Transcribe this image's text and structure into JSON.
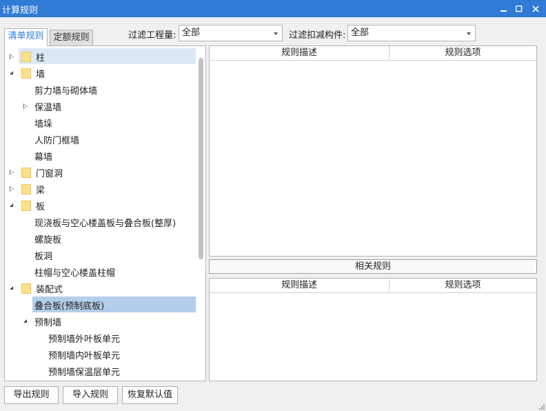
{
  "window": {
    "title": "计算规则",
    "minimize": "—",
    "maximize": "☐",
    "close": "✕"
  },
  "tabs": {
    "active": "清单规则",
    "inactive": "定额规则"
  },
  "filters": {
    "quantity_label": "过滤工程量:",
    "quantity_value": "全部",
    "deduct_label": "过滤扣减构件:",
    "deduct_value": "全部"
  },
  "tree": {
    "items": [
      {
        "label": "柱",
        "level": 0,
        "expander": "collapsed",
        "folder": true,
        "state": "hover"
      },
      {
        "label": "墙",
        "level": 0,
        "expander": "expanded",
        "folder": true
      },
      {
        "label": "剪力墙与砌体墙",
        "level": 1
      },
      {
        "label": "保温墙",
        "level": 1,
        "expander": "collapsed"
      },
      {
        "label": "墙垛",
        "level": 1
      },
      {
        "label": "人防门框墙",
        "level": 1
      },
      {
        "label": "幕墙",
        "level": 1
      },
      {
        "label": "门窗洞",
        "level": 0,
        "expander": "collapsed",
        "folder": true
      },
      {
        "label": "梁",
        "level": 0,
        "expander": "collapsed",
        "folder": true
      },
      {
        "label": "板",
        "level": 0,
        "expander": "expanded",
        "folder": true
      },
      {
        "label": "现浇板与空心楼盖板与叠合板(整厚)",
        "level": 1
      },
      {
        "label": "螺旋板",
        "level": 1
      },
      {
        "label": "板洞",
        "level": 1
      },
      {
        "label": "柱帽与空心楼盖柱帽",
        "level": 1
      },
      {
        "label": "装配式",
        "level": 0,
        "expander": "expanded",
        "folder": true
      },
      {
        "label": "叠合板(预制底板)",
        "level": 1,
        "state": "selected"
      },
      {
        "label": "预制墙",
        "level": 1,
        "expander": "expanded"
      },
      {
        "label": "预制墙外叶板单元",
        "level": 2
      },
      {
        "label": "预制墙内叶板单元",
        "level": 2
      },
      {
        "label": "预制墙保温层单元",
        "level": 2
      }
    ]
  },
  "rules_table": {
    "col_desc": "规则描述",
    "col_option": "规则选项"
  },
  "related": {
    "label": "相关规则"
  },
  "related_table": {
    "col_desc": "规则描述",
    "col_option": "规则选项"
  },
  "buttons": {
    "export": "导出规则",
    "import": "导入规则",
    "restore": "恢复默认值"
  },
  "colors": {
    "accent": "#2f7bd6",
    "selected_row": "#b4cdea",
    "hover_row": "#dde8f5",
    "folder": "#fbe18a"
  }
}
